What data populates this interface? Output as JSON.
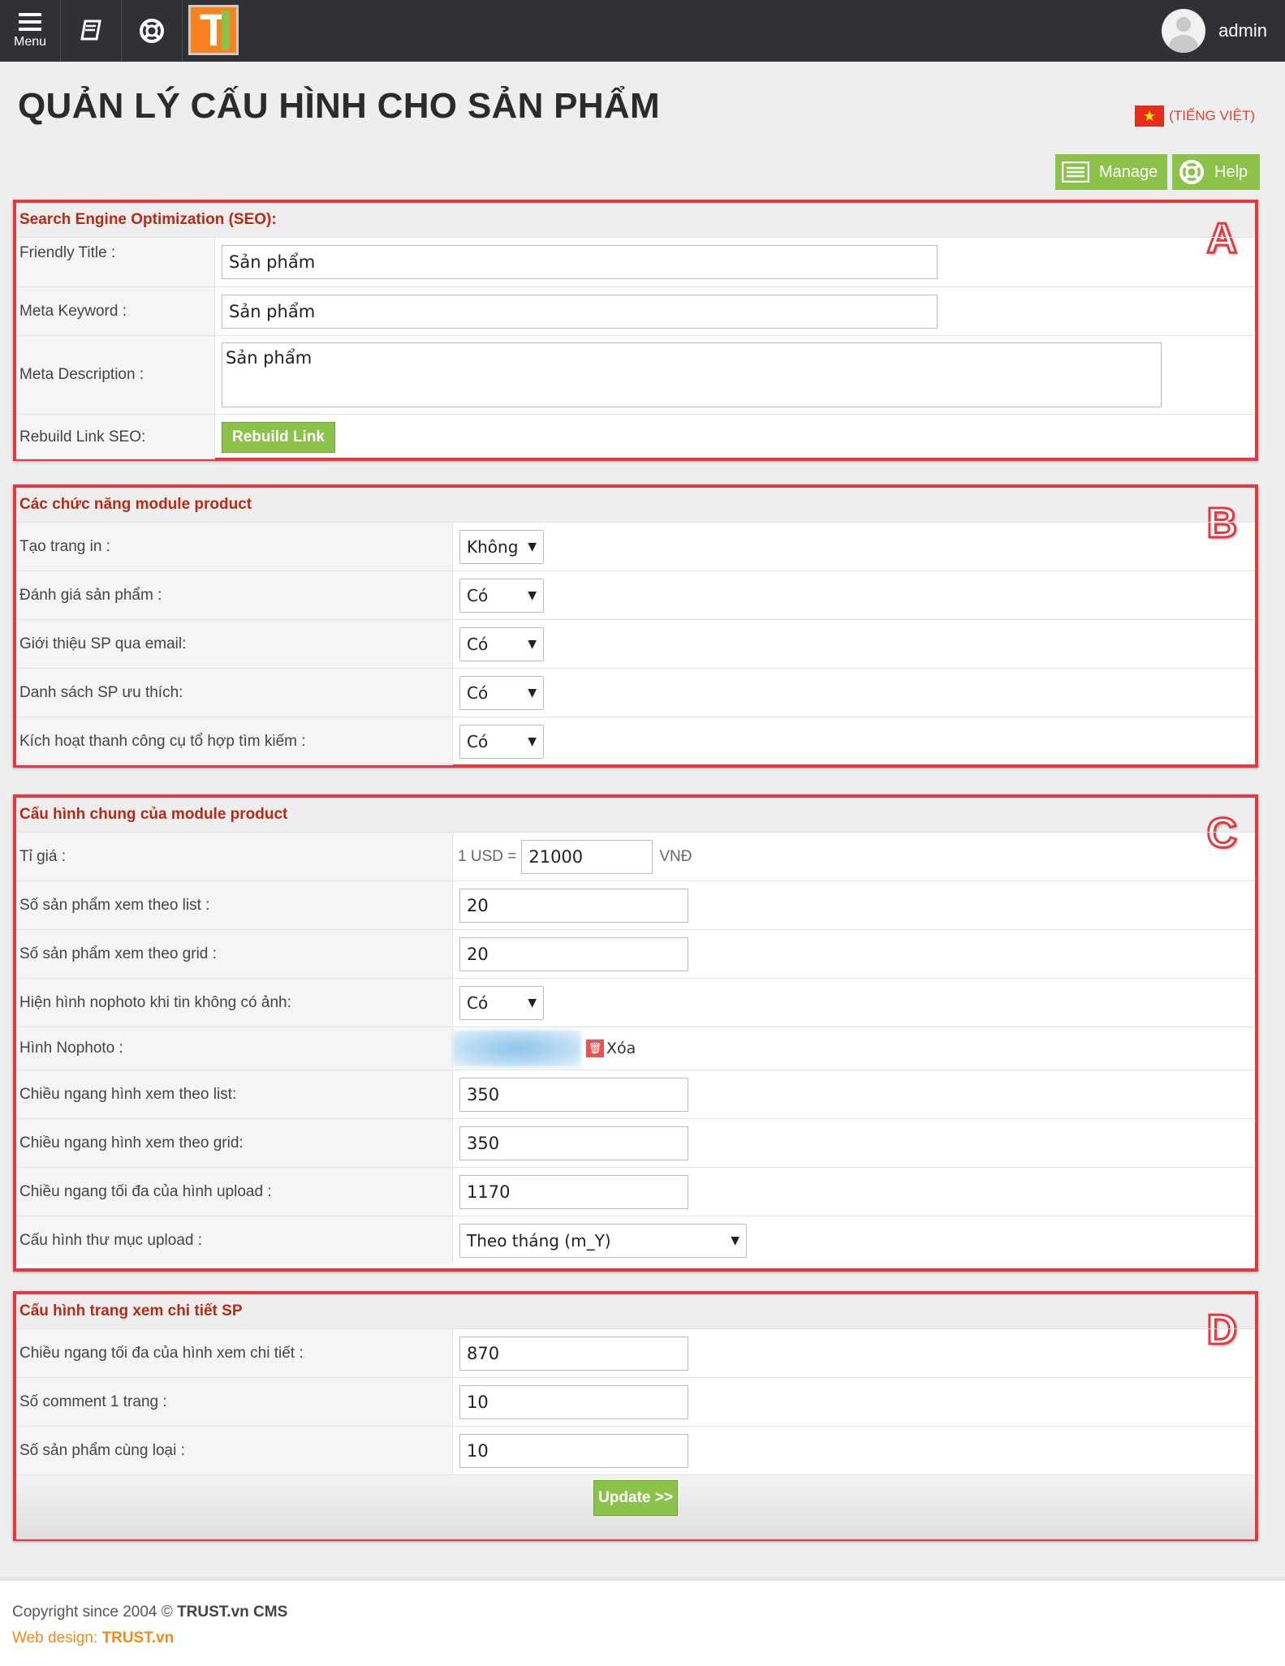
{
  "topbar": {
    "menu_label": "Menu",
    "user_name": "admin"
  },
  "page": {
    "title": "QUẢN LÝ CẤU HÌNH CHO SẢN PHẨM",
    "language": "(TIẾNG VIỆT)"
  },
  "toolbar": {
    "manage_label": "Manage",
    "help_label": "Help"
  },
  "seo": {
    "heading": "Search Engine Optimization (SEO):",
    "friendly_title_label": "Friendly Title :",
    "friendly_title_value": "Sản phẩm",
    "meta_keyword_label": "Meta Keyword :",
    "meta_keyword_value": "Sản phẩm",
    "meta_description_label": "Meta Description :",
    "meta_description_value": "Sản phẩm",
    "rebuild_label": "Rebuild Link SEO:",
    "rebuild_button": "Rebuild Link",
    "marker": "A"
  },
  "functions": {
    "heading": "Các chức năng module product",
    "marker": "B",
    "rows": [
      {
        "label": "Tạo trang in :",
        "value": "Không"
      },
      {
        "label": "Đánh giá sản phẩm :",
        "value": "Có"
      },
      {
        "label": "Giới thiệu SP qua email:",
        "value": "Có"
      },
      {
        "label": "Danh sách SP ưu thích:",
        "value": "Có"
      },
      {
        "label": "Kích hoạt thanh công cụ tổ hợp tìm kiếm :",
        "value": "Có"
      }
    ]
  },
  "general": {
    "heading": "Cấu hình chung của module product",
    "marker": "C",
    "rate_label": "Tỉ giá :",
    "rate_prefix": "1 USD =",
    "rate_value": "21000",
    "rate_suffix": "VNĐ",
    "list_count_label": "Số sản phẩm xem theo list :",
    "list_count_value": "20",
    "grid_count_label": "Số sản phẩm xem theo grid :",
    "grid_count_value": "20",
    "nophoto_show_label": "Hiện hình nophoto khi tin không có ảnh:",
    "nophoto_show_value": "Có",
    "nophoto_image_label": "Hình Nophoto :",
    "delete_label": "Xóa",
    "list_width_label": "Chiều ngang hình xem theo list:",
    "list_width_value": "350",
    "grid_width_label": "Chiều ngang hình xem theo grid:",
    "grid_width_value": "350",
    "upload_max_label": "Chiều ngang tối đa của hình upload :",
    "upload_max_value": "1170",
    "upload_folder_label": "Cấu hình thư mục upload :",
    "upload_folder_value": "Theo tháng (m_Y)"
  },
  "detail": {
    "heading": "Cấu hình trang xem chi tiết SP",
    "marker": "D",
    "detail_width_label": "Chiều ngang tối đa của hình xem chi tiết :",
    "detail_width_value": "870",
    "comments_label": "Số comment 1 trang :",
    "comments_value": "10",
    "related_label": "Số sản phẩm cùng loại :",
    "related_value": "10",
    "update_button": "Update >>"
  },
  "footer": {
    "copyright_prefix": "Copyright since 2004 ©",
    "copyright_brand": "TRUST.vn CMS",
    "design_prefix": "Web design:",
    "design_brand": "TRUST.vn"
  }
}
